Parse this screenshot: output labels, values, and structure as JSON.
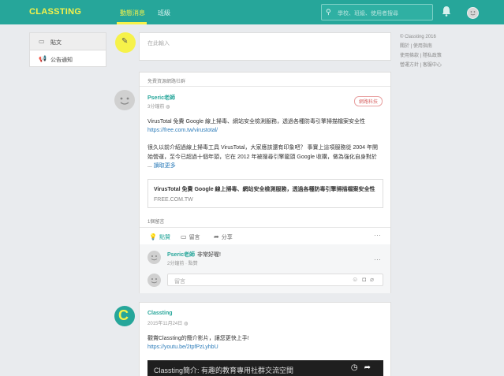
{
  "header": {
    "logo": "CLASSTING",
    "nav": [
      "動態消息",
      "班級"
    ],
    "search_placeholder": "學校、班級、使用者搜尋"
  },
  "sidebar": {
    "items": [
      {
        "label": "貼文",
        "icon": "post-icon"
      },
      {
        "label": "公告通知",
        "icon": "megaphone-icon"
      }
    ]
  },
  "composer": {
    "placeholder": "在此輸入"
  },
  "footer": {
    "copyright": "© Classting 2016",
    "links": [
      "關於",
      "使用指南",
      "使用條款",
      "隱私政策",
      "營運方針",
      "客服中心"
    ]
  },
  "posts": [
    {
      "header": "免費資源網路社群",
      "author": "Pseric老師",
      "time": "3分鐘前",
      "tag": "網路科技",
      "text1": "VirusTotal 免費 Google 線上掃毒、網站安全檢測服務，透過各種防毒引擎掃描檔案安全性",
      "url1": "https://free.com.tw/virustotal/",
      "text2a": "很久以前介紹過線上掃毒工具 VirusTotal，大家應該還有印象吧？ 事實上這項服務從 2004 年開",
      "text2b": "始營運，至今已超過十個年頭，它在 2012 年被搜尋引擎龍頭 Google 收購，做為強化自身對於",
      "text2c": "... ",
      "read_more": "讀取更多",
      "card_title": "VirusTotal 免費 Google 線上掃毒、網站安全檢測服務，透過各種防毒引擎掃描檔案安全性",
      "card_source": "FREE.COM.TW",
      "comment_count": "1個留言",
      "actions": [
        "點贊",
        "留言",
        "分享"
      ],
      "comment": {
        "author": "Pseric老師",
        "text": "非常好喔!",
        "time": "2分鐘前 · 點贊"
      },
      "comment_placeholder": "留言"
    },
    {
      "author": "Classting",
      "time": "2015年11月24日",
      "text": "觀賞Classting的簡介影片，讓您更快上手!",
      "url": "https://youtu.be/2tpfPzLyhbU",
      "video_title": "Classting簡介: 有趣的教育專用社群交流空間"
    }
  ]
}
